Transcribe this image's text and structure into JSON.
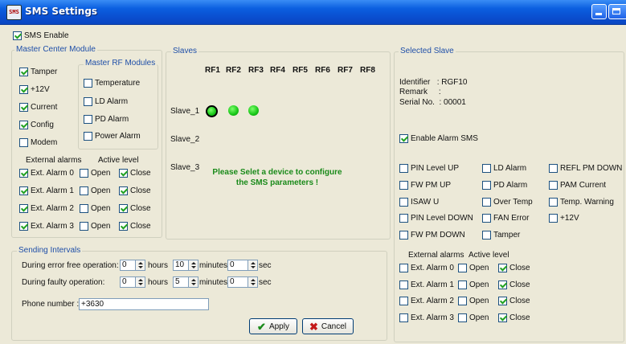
{
  "window": {
    "title": "SMS Settings",
    "icon_text": "SMS"
  },
  "sms_enable": {
    "label": "SMS Enable",
    "checked": true
  },
  "master_center": {
    "legend": "Master Center Module",
    "items": [
      {
        "label": "Tamper",
        "checked": true
      },
      {
        "label": "+12V",
        "checked": true
      },
      {
        "label": "Current",
        "checked": true
      },
      {
        "label": "Config",
        "checked": true
      },
      {
        "label": "Modem",
        "checked": false
      }
    ],
    "rf_modules_legend": "Master RF Modules",
    "rf_modules": [
      {
        "label": "Temperature",
        "checked": false
      },
      {
        "label": "LD Alarm",
        "checked": false
      },
      {
        "label": "PD Alarm",
        "checked": false
      },
      {
        "label": "Power Alarm",
        "checked": false
      }
    ],
    "external_header": "External alarms",
    "active_header": "Active level",
    "alarms": [
      {
        "label": "Ext. Alarm 0",
        "checked": true,
        "open": false,
        "close": true
      },
      {
        "label": "Ext. Alarm 1",
        "checked": true,
        "open": false,
        "close": true
      },
      {
        "label": "Ext. Alarm 2",
        "checked": true,
        "open": false,
        "close": true
      },
      {
        "label": "Ext. Alarm 3",
        "checked": true,
        "open": false,
        "close": true
      }
    ],
    "open_label": "Open",
    "close_label": "Close"
  },
  "slaves": {
    "legend": "Slaves",
    "columns": [
      "RF1",
      "RF2",
      "RF3",
      "RF4",
      "RF5",
      "RF6",
      "RF7",
      "RF8"
    ],
    "rows": [
      "Slave_1",
      "Slave_2",
      "Slave_3"
    ],
    "message_line1": "Please Selet a device to configure",
    "message_line2": "the SMS parameters !"
  },
  "sending": {
    "legend": "Sending Intervals",
    "error_free_label": "During error free operation:",
    "faulty_label": "During faulty operation:",
    "error_free": {
      "hours": "0",
      "minutes": "10",
      "sec": "0"
    },
    "faulty": {
      "hours": "0",
      "minutes": "5",
      "sec": "0"
    },
    "hours_label": "hours",
    "minutes_label": "minutes",
    "sec_label": "sec",
    "phone_label": "Phone number :",
    "phone_value": "+3630",
    "apply_label": "Apply",
    "cancel_label": "Cancel"
  },
  "selected": {
    "legend": "Selected Slave",
    "identifier": "Identifier   : RGF10",
    "remark": "Remark     :",
    "serial": "Serial No.  : 00001",
    "enable_alarm": {
      "label": "Enable Alarm SMS",
      "checked": true
    },
    "col1": [
      {
        "label": "PIN Level UP",
        "checked": false
      },
      {
        "label": "FW PM UP",
        "checked": false
      },
      {
        "label": "ISAW U",
        "checked": false
      },
      {
        "label": "PIN Level DOWN",
        "checked": false
      },
      {
        "label": "FW PM DOWN",
        "checked": false
      }
    ],
    "col2": [
      {
        "label": "LD Alarm",
        "checked": false
      },
      {
        "label": "PD Alarm",
        "checked": false
      },
      {
        "label": "Over Temp",
        "checked": false
      },
      {
        "label": "FAN Error",
        "checked": false
      },
      {
        "label": "Tamper",
        "checked": false
      }
    ],
    "col3": [
      {
        "label": "REFL PM DOWN",
        "checked": false
      },
      {
        "label": "PAM Current",
        "checked": false
      },
      {
        "label": "Temp. Warning",
        "checked": false
      },
      {
        "label": "+12V",
        "checked": false
      }
    ],
    "external_header": "External alarms",
    "active_header": "Active level",
    "alarms": [
      {
        "label": "Ext. Alarm 0",
        "checked": false,
        "open": false,
        "close": true
      },
      {
        "label": "Ext. Alarm 1",
        "checked": false,
        "open": false,
        "close": true
      },
      {
        "label": "Ext. Alarm 2",
        "checked": false,
        "open": false,
        "close": true
      },
      {
        "label": "Ext. Alarm 3",
        "checked": false,
        "open": false,
        "close": true
      }
    ],
    "open_label": "Open",
    "close_label": "Close"
  },
  "colors": {
    "title_bar": "#0a4fd0",
    "legend_text": "#1f4fa8",
    "message_text": "#1a8a1a",
    "led_on": "#17c617",
    "check_mark": "#21a121"
  }
}
